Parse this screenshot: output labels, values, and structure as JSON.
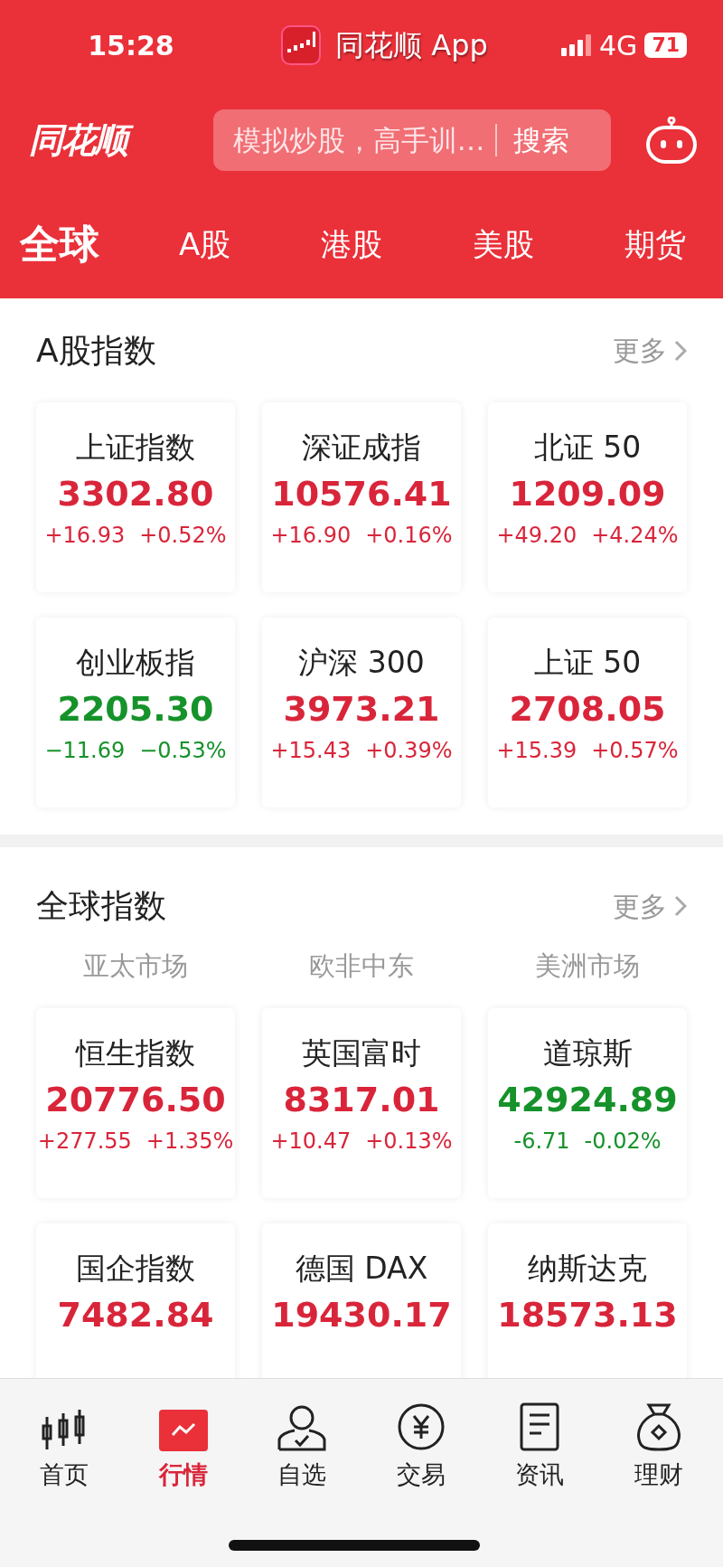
{
  "status_bar": {
    "time": "15:28",
    "app": "同花顺 App",
    "network": "4G",
    "battery": "71"
  },
  "header": {
    "logo": "同花顺",
    "search": {
      "placeholder": "模拟炒股，高手训…",
      "button": "搜索"
    }
  },
  "tabs": [
    {
      "label": "全球",
      "selected": true
    },
    {
      "label": "A股",
      "selected": false
    },
    {
      "label": "港股",
      "selected": false
    },
    {
      "label": "美股",
      "selected": false
    },
    {
      "label": "期货",
      "selected": false
    }
  ],
  "sections": [
    {
      "title": "A股指数",
      "more": "更多",
      "cards": [
        {
          "name": "上证指数",
          "value": "3302.80",
          "change": "+16.93",
          "percent": "+0.52%",
          "color": "#d9253a"
        },
        {
          "name": "深证成指",
          "value": "10576.41",
          "change": "+16.90",
          "percent": "+0.16%",
          "color": "#d9253a"
        },
        {
          "name": "北证 50",
          "value": "1209.09",
          "change": "+49.20",
          "percent": "+4.24%",
          "color": "#d9253a"
        },
        {
          "name": "创业板指",
          "value": "2205.30",
          "change": "−11.69",
          "percent": "−0.53%",
          "color": "#16922a"
        },
        {
          "name": "沪深 300",
          "value": "3973.21",
          "change": "+15.43",
          "percent": "+0.39%",
          "color": "#d9253a"
        },
        {
          "name": "上证 50",
          "value": "2708.05",
          "change": "+15.39",
          "percent": "+0.57%",
          "color": "#d9253a"
        }
      ]
    },
    {
      "title": "全球指数",
      "more": "更多",
      "markets": [
        "亚太市场",
        "欧非中东",
        "美洲市场"
      ],
      "cards": [
        {
          "name": "恒生指数",
          "value": "20776.50",
          "change": "+277.55",
          "percent": "+1.35%",
          "color": "#d9253a"
        },
        {
          "name": "英国富时",
          "value": "8317.01",
          "change": "+10.47",
          "percent": "+0.13%",
          "color": "#d9253a"
        },
        {
          "name": "道琼斯",
          "value": "42924.89",
          "change": "-6.71",
          "percent": "-0.02%",
          "color": "#16922a"
        },
        {
          "name": "国企指数",
          "value": "7482.84",
          "color": "#d9253a"
        },
        {
          "name": "德国 DAX",
          "value": "19430.17",
          "color": "#d9253a"
        },
        {
          "name": "纳斯达克",
          "value": "18573.13",
          "color": "#d9253a"
        }
      ]
    }
  ],
  "bottom_nav": [
    {
      "label": "首页",
      "selected": false
    },
    {
      "label": "行情",
      "selected": true
    },
    {
      "label": "自选",
      "selected": false
    },
    {
      "label": "交易",
      "selected": false
    },
    {
      "label": "资讯",
      "selected": false
    },
    {
      "label": "理财",
      "selected": false
    }
  ]
}
